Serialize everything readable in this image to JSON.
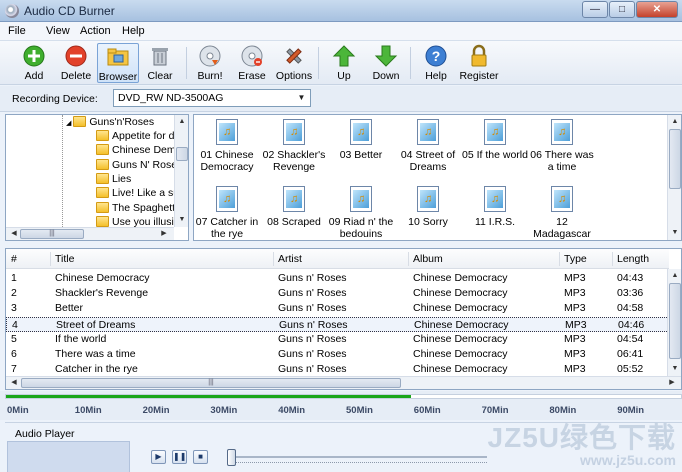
{
  "window": {
    "title": "Audio CD Burner"
  },
  "menu": [
    "File",
    "View",
    "Action",
    "Help"
  ],
  "toolbar": {
    "add": "Add",
    "delete": "Delete",
    "browser": "Browser",
    "clear": "Clear",
    "burn": "Burn!",
    "erase": "Erase",
    "options": "Options",
    "up": "Up",
    "down": "Down",
    "help": "Help",
    "register": "Register"
  },
  "device": {
    "label": "Recording Device:",
    "value": "DVD_RW ND-3500AG"
  },
  "tree": {
    "root": "Guns'n'Roses",
    "items": [
      "Appetite for d",
      "Chinese Demo",
      "Guns N' Roses",
      "Lies",
      "Live! Like a su",
      "The Spaghetti",
      "Use you illusio"
    ]
  },
  "files": [
    "01 Chinese Democracy",
    "02 Shackler's Revenge",
    "03 Better",
    "04 Street of Dreams",
    "05 If the world",
    "06 There was a time",
    "07 Catcher in the rye",
    "08 Scraped",
    "09 Riad n' the bedouins",
    "10 Sorry",
    "11 I.R.S.",
    "12 Madagascar"
  ],
  "table": {
    "headers": [
      "#",
      "Title",
      "Artist",
      "Album",
      "Type",
      "Length"
    ],
    "rows": [
      [
        "1",
        "Chinese Democracy",
        "Guns n' Roses",
        "Chinese Democracy",
        "MP3",
        "04:43"
      ],
      [
        "2",
        "Shackler's Revenge",
        "Guns n' Roses",
        "Chinese Democracy",
        "MP3",
        "03:36"
      ],
      [
        "3",
        "Better",
        "Guns n' Roses",
        "Chinese Democracy",
        "MP3",
        "04:58"
      ],
      [
        "4",
        "Street of Dreams",
        "Guns n' Roses",
        "Chinese Democracy",
        "MP3",
        "04:46"
      ],
      [
        "5",
        "If the world",
        "Guns n' Roses",
        "Chinese Democracy",
        "MP3",
        "04:54"
      ],
      [
        "6",
        "There was a time",
        "Guns n' Roses",
        "Chinese Democracy",
        "MP3",
        "06:41"
      ],
      [
        "7",
        "Catcher in the rye",
        "Guns n' Roses",
        "Chinese Democracy",
        "MP3",
        "05:52"
      ]
    ],
    "selected_row": 3
  },
  "timeline": {
    "marks": [
      "0Min",
      "10Min",
      "20Min",
      "30Min",
      "40Min",
      "50Min",
      "60Min",
      "70Min",
      "80Min",
      "90Min"
    ],
    "progress_fraction": 0.6,
    "progress_color": "#1aa51a"
  },
  "player": {
    "label": "Audio Player"
  },
  "watermark": {
    "main": "JZ5U绿色下载",
    "sub": "www.jz5u.com"
  },
  "colors": {
    "accent": "#7aa3d6",
    "selection": "#eef3fb"
  }
}
